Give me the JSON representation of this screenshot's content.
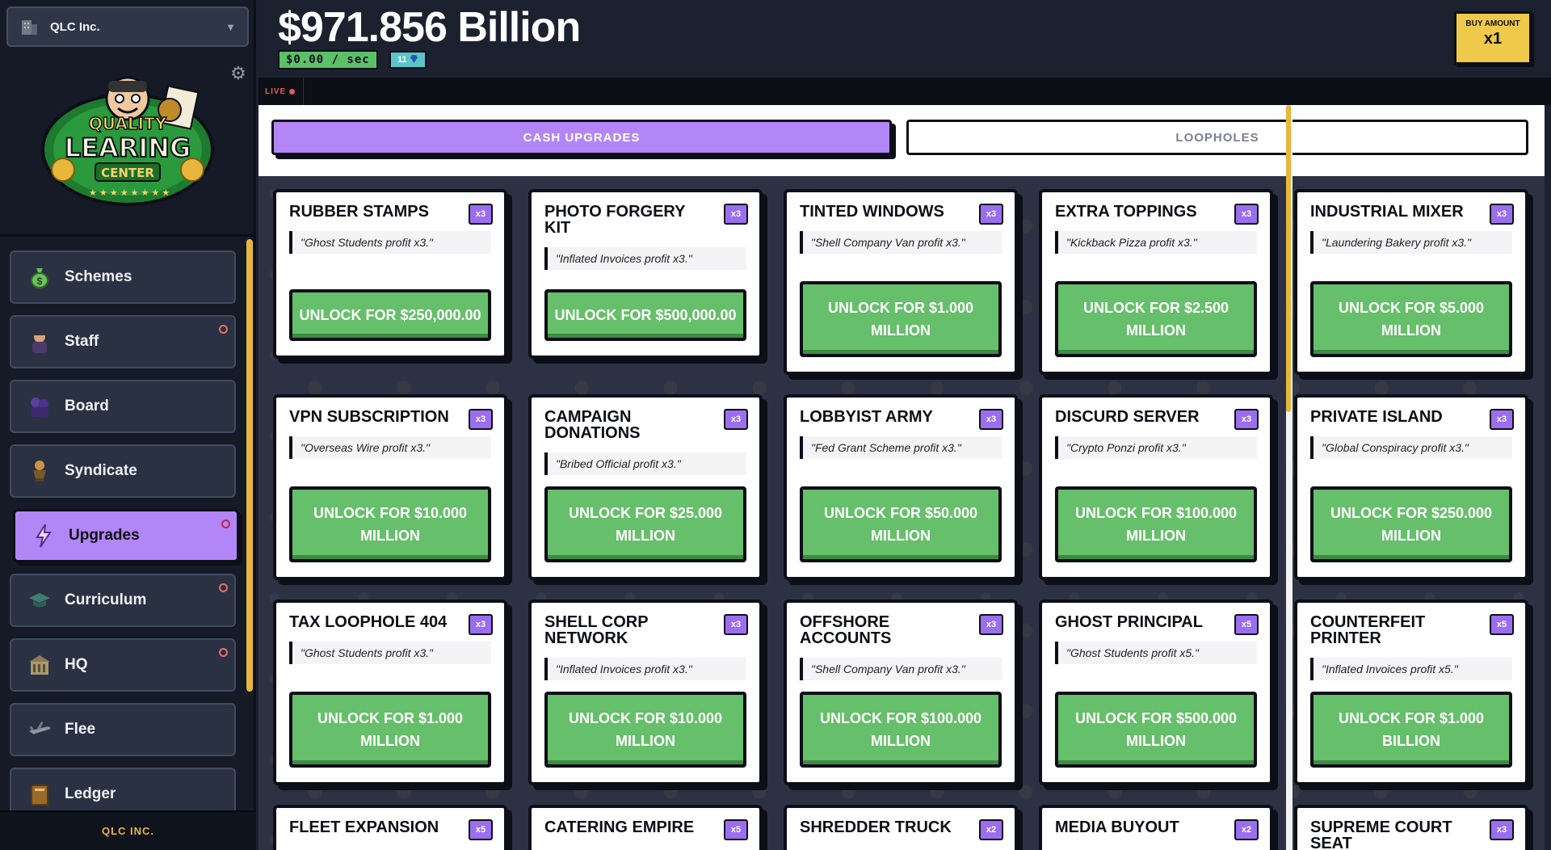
{
  "company": {
    "name": "QLC Inc."
  },
  "logo": {
    "line1": "QUALITY",
    "line2": "LEARING",
    "line3": "CENTER"
  },
  "nav": [
    {
      "label": "Schemes",
      "icon": "money-bag-icon",
      "badge": false,
      "active": false
    },
    {
      "label": "Staff",
      "icon": "staff-icon",
      "badge": true,
      "active": false
    },
    {
      "label": "Board",
      "icon": "board-icon",
      "badge": false,
      "active": false
    },
    {
      "label": "Syndicate",
      "icon": "trophy-icon",
      "badge": false,
      "active": false
    },
    {
      "label": "Upgrades",
      "icon": "lightning-icon",
      "badge": true,
      "active": true
    },
    {
      "label": "Curriculum",
      "icon": "grad-cap-icon",
      "badge": true,
      "active": false
    },
    {
      "label": "HQ",
      "icon": "building-icon",
      "badge": true,
      "active": false
    },
    {
      "label": "Flee",
      "icon": "plane-icon",
      "badge": false,
      "active": false
    },
    {
      "label": "Ledger",
      "icon": "book-icon",
      "badge": false,
      "active": false
    }
  ],
  "footer": {
    "label": "QLC INC."
  },
  "header": {
    "balance": "$971.856 Billion",
    "rate": "$0.00 / sec",
    "gems": "11",
    "buy_label": "BUY AMOUNT",
    "buy_value": "x1"
  },
  "ticker": {
    "live": "LIVE"
  },
  "tabs": {
    "cash": "CASH UPGRADES",
    "loopholes": "LOOPHOLES"
  },
  "cards": [
    {
      "title": "RUBBER STAMPS",
      "mult": "x3",
      "desc": "\"Ghost Students profit x3.\"",
      "button": "UNLOCK FOR $250,000.00",
      "style": "one"
    },
    {
      "title": "PHOTO FORGERY KIT",
      "mult": "x3",
      "desc": "\"Inflated Invoices profit x3.\"",
      "button": "UNLOCK FOR $500,000.00",
      "style": "one"
    },
    {
      "title": "TINTED WINDOWS",
      "mult": "x3",
      "desc": "\"Shell Company Van profit x3.\"",
      "button": "UNLOCK FOR $1.000 MILLION",
      "style": "two"
    },
    {
      "title": "EXTRA TOPPINGS",
      "mult": "x3",
      "desc": "\"Kickback Pizza profit x3.\"",
      "button": "UNLOCK FOR $2.500 MILLION",
      "style": "two"
    },
    {
      "title": "INDUSTRIAL MIXER",
      "mult": "x3",
      "desc": "\"Laundering Bakery profit x3.\"",
      "button": "UNLOCK FOR $5.000 MILLION",
      "style": "two"
    },
    {
      "title": "VPN SUBSCRIPTION",
      "mult": "x3",
      "desc": "\"Overseas Wire profit x3.\"",
      "button": "UNLOCK FOR $10.000 MILLION",
      "style": "two"
    },
    {
      "title": "CAMPAIGN DONATIONS",
      "mult": "x3",
      "desc": "\"Bribed Official profit x3.\"",
      "button": "UNLOCK FOR $25.000 MILLION",
      "style": "two"
    },
    {
      "title": "LOBBYIST ARMY",
      "mult": "x3",
      "desc": "\"Fed Grant Scheme profit x3.\"",
      "button": "UNLOCK FOR $50.000 MILLION",
      "style": "two"
    },
    {
      "title": "DISCURD SERVER",
      "mult": "x3",
      "desc": "\"Crypto Ponzi profit x3.\"",
      "button": "UNLOCK FOR $100.000 MILLION",
      "style": "two"
    },
    {
      "title": "PRIVATE ISLAND",
      "mult": "x3",
      "desc": "\"Global Conspiracy profit x3.\"",
      "button": "UNLOCK FOR $250.000 MILLION",
      "style": "two"
    },
    {
      "title": "TAX LOOPHOLE 404",
      "mult": "x3",
      "desc": "\"Ghost Students profit x3.\"",
      "button": "UNLOCK FOR $1.000 MILLION",
      "style": "two"
    },
    {
      "title": "SHELL CORP NETWORK",
      "mult": "x3",
      "desc": "\"Inflated Invoices profit x3.\"",
      "button": "UNLOCK FOR $10.000 MILLION",
      "style": "two"
    },
    {
      "title": "OFFSHORE ACCOUNTS",
      "mult": "x3",
      "desc": "\"Shell Company Van profit x3.\"",
      "button": "UNLOCK FOR $100.000 MILLION",
      "style": "two"
    },
    {
      "title": "GHOST PRINCIPAL",
      "mult": "x5",
      "desc": "\"Ghost Students profit x5.\"",
      "button": "UNLOCK FOR $500.000 MILLION",
      "style": "two"
    },
    {
      "title": "COUNTERFEIT PRINTER",
      "mult": "x5",
      "desc": "\"Inflated Invoices profit x5.\"",
      "button": "UNLOCK FOR $1.000 BILLION",
      "style": "two"
    },
    {
      "title": "FLEET EXPANSION",
      "mult": "x5",
      "desc": "",
      "button": "",
      "style": "partial"
    },
    {
      "title": "CATERING EMPIRE",
      "mult": "x5",
      "desc": "",
      "button": "",
      "style": "partial"
    },
    {
      "title": "SHREDDER TRUCK",
      "mult": "x2",
      "desc": "",
      "button": "",
      "style": "partial"
    },
    {
      "title": "MEDIA BUYOUT",
      "mult": "x2",
      "desc": "",
      "button": "",
      "style": "partial"
    },
    {
      "title": "SUPREME COURT SEAT",
      "mult": "x3",
      "desc": "",
      "button": "",
      "style": "partial"
    }
  ],
  "colors": {
    "accent": "#b286f7",
    "unlock": "#66bf6a",
    "gold": "#e7b73c",
    "sidebar": "#151a26"
  }
}
